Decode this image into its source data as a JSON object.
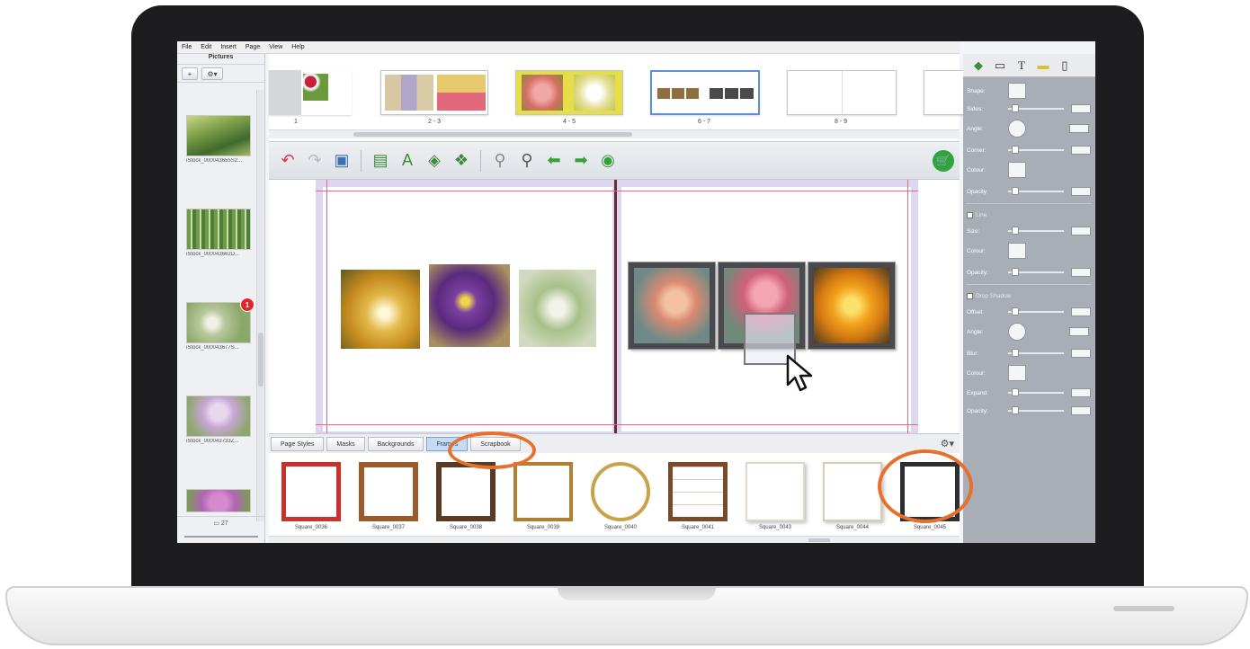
{
  "menu": [
    "File",
    "Edit",
    "Insert",
    "Page",
    "View",
    "Help"
  ],
  "pictures": {
    "title": "Pictures",
    "add_label": "+",
    "gear_label": "⚙▾",
    "items": [
      {
        "caption": "iStock_000043655S2..."
      },
      {
        "caption": "iStock_000043662D..."
      },
      {
        "caption": "iStock_000043677S...",
        "badge": "1"
      },
      {
        "caption": "iStock_000043733Z..."
      },
      {
        "caption": ""
      }
    ],
    "count": "27"
  },
  "pages": [
    {
      "label": "1"
    },
    {
      "label": "2 - 3"
    },
    {
      "label": "4 - 5"
    },
    {
      "label": "6 - 7"
    },
    {
      "label": "8 - 9"
    }
  ],
  "toolbar": {
    "icons": [
      "undo-icon",
      "redo-icon",
      "save-icon",
      "add-photo-icon",
      "add-text-icon",
      "add-shape-icon",
      "add-clipart-icon",
      "zoom-out-icon",
      "zoom-in-icon",
      "previous-page-icon",
      "next-page-icon",
      "preview-icon"
    ],
    "cart_icon": "cart-icon"
  },
  "tabs": [
    {
      "label": "Page Styles",
      "selected": false
    },
    {
      "label": "Masks",
      "selected": false
    },
    {
      "label": "Backgrounds",
      "selected": false
    },
    {
      "label": "Frames",
      "selected": true
    },
    {
      "label": "Scrapbook",
      "selected": false
    }
  ],
  "frames": [
    {
      "caption": "Square_0036",
      "style": "red"
    },
    {
      "caption": "Square_0037",
      "style": "wood"
    },
    {
      "caption": "Square_0038",
      "style": "dark-wood"
    },
    {
      "caption": "Square_0039",
      "style": "gold-thin"
    },
    {
      "caption": "Square_0040",
      "style": "round-gold"
    },
    {
      "caption": "Square_0041",
      "style": "grid"
    },
    {
      "caption": "Square_0043",
      "style": "white-shadow"
    },
    {
      "caption": "Square_0044",
      "style": "white-shadow"
    },
    {
      "caption": "Square_0045",
      "style": "black"
    }
  ],
  "properties": {
    "shape": "Shape:",
    "sides": "Sides:",
    "angle": "Angle:",
    "corner": "Corner:",
    "colour": "Colour:",
    "opacity": "Opacity:",
    "line": "Line",
    "size": "Size:",
    "line_colour": "Colour:",
    "line_opacity": "Opacity:",
    "drop_shadow": "Drop Shadow",
    "offset": "Offset:",
    "shadow_angle": "Angle:",
    "blur": "Blur:",
    "shadow_colour": "Colour:",
    "expand": "Expand:",
    "shadow_opacity": "Opacity:"
  },
  "accent_colors": {
    "annotation": "#e8702e",
    "selected_tab": "#c6daf2",
    "cart": "#2fa53c",
    "badge": "#e0262b"
  }
}
